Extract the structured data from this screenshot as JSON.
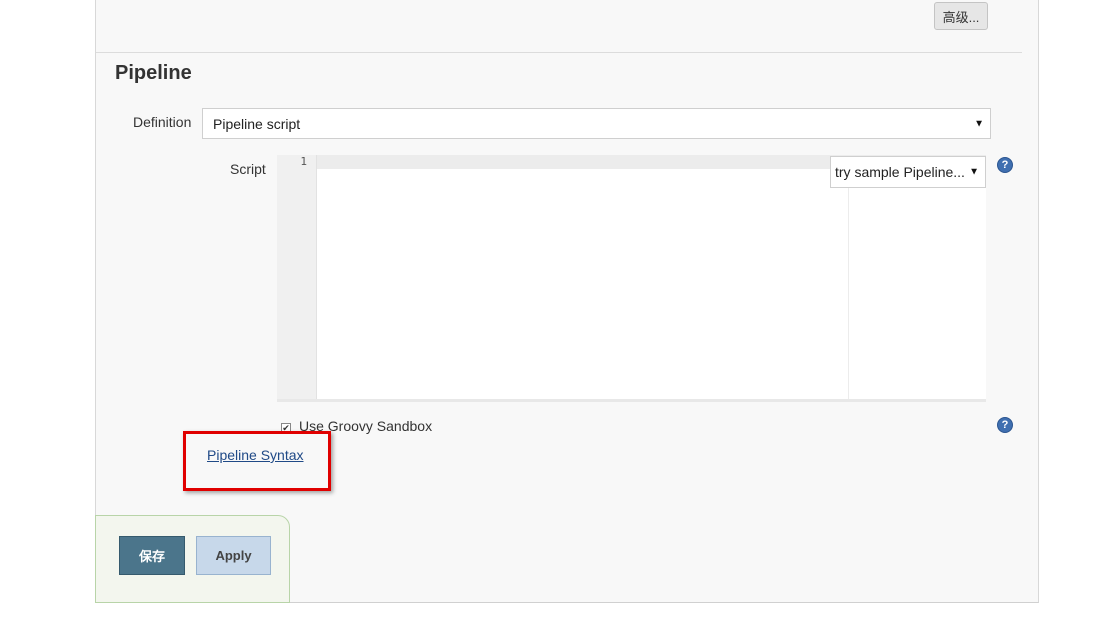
{
  "advanced_button": {
    "label": "高级..."
  },
  "pipeline": {
    "section_title": "Pipeline",
    "definition": {
      "label": "Definition",
      "selected": "Pipeline script"
    },
    "script": {
      "label": "Script",
      "line_numbers": [
        "1"
      ],
      "content": "",
      "sample_select": "try sample Pipeline..."
    },
    "sandbox": {
      "label": "Use Groovy Sandbox",
      "checked": true
    },
    "syntax_link": "Pipeline Syntax"
  },
  "help_icon": "?",
  "actions": {
    "save_label": "保存",
    "apply_label": "Apply"
  },
  "colors": {
    "save_bg": "#4b758b",
    "apply_bg": "#c7d8ea",
    "highlight": "#e00000",
    "link": "#204a87"
  }
}
